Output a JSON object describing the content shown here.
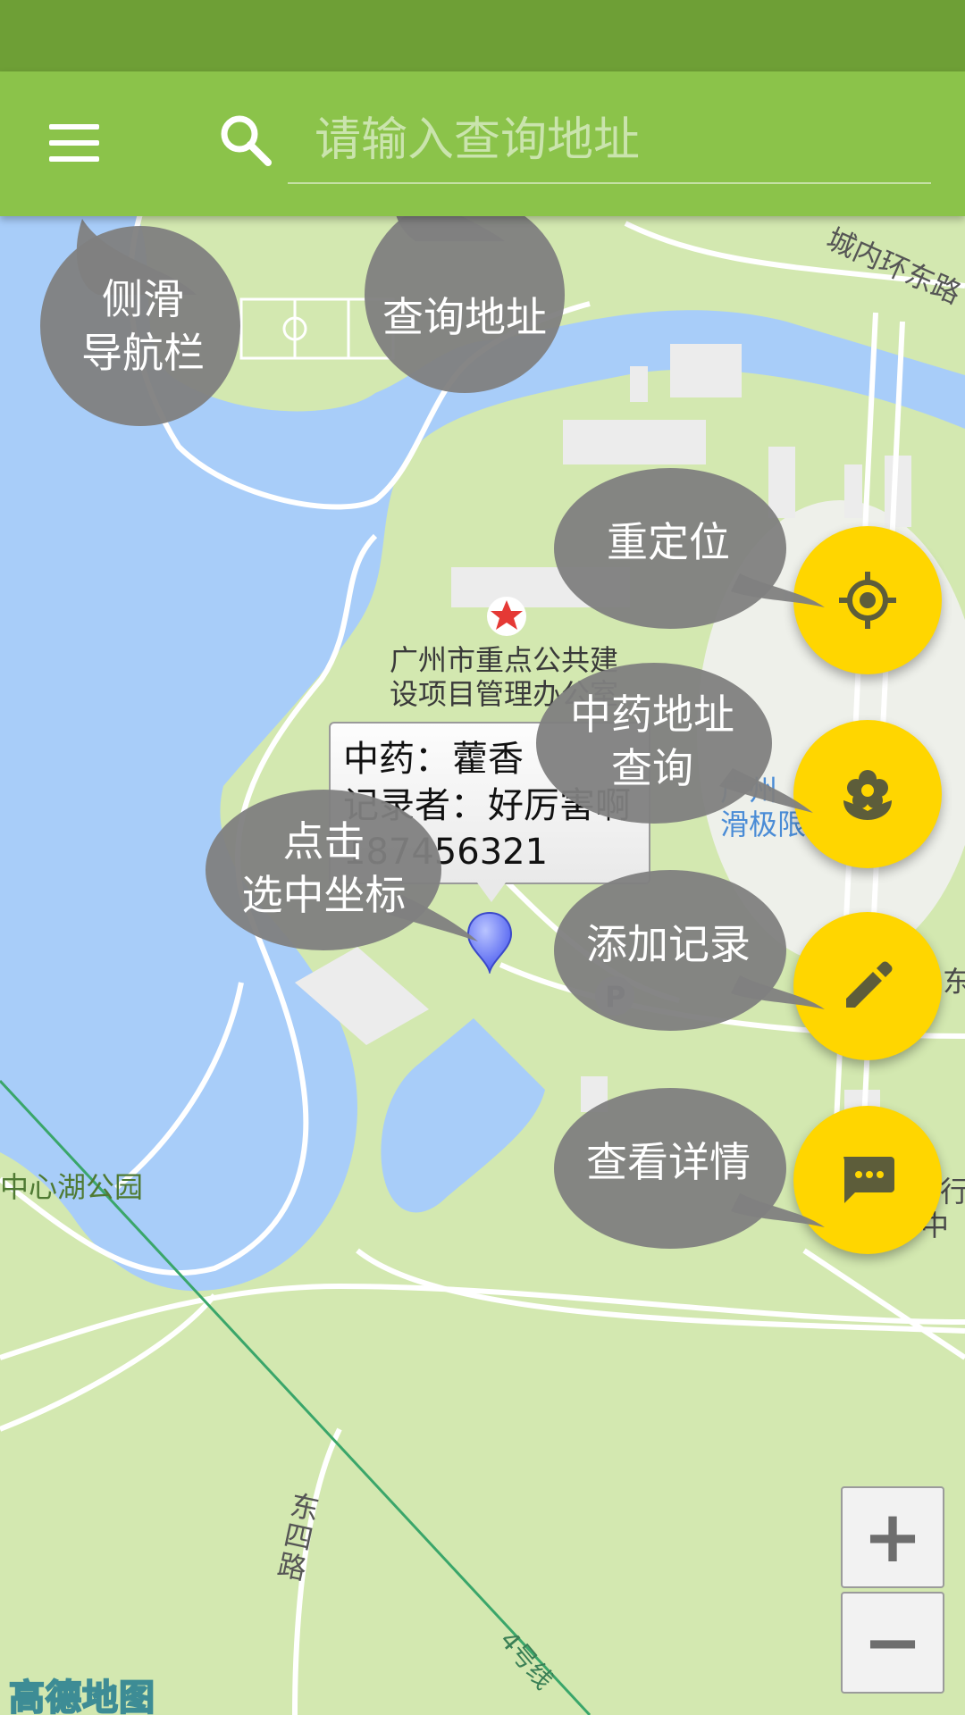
{
  "app_bar": {
    "search_placeholder": "请输入查询地址"
  },
  "colors": {
    "status_bar": "#6e9f36",
    "app_bar": "#8bc34a",
    "fab": "#ffd600",
    "bubble": "#808080",
    "water": "#a8cdf9",
    "park": "#d3e8b0"
  },
  "map": {
    "labels": {
      "poi_office": "广州市重点公共建\n设项目管理办公室",
      "road_east": "城内环东路",
      "park_lake": "中心湖公园",
      "ski_venue": "广州\n滑极限",
      "road_dongsi": "东\n四\n路",
      "road_line4": "4号线",
      "edge_dong": "东",
      "edge_xing": "行",
      "edge_zhong": "中",
      "parking": "P"
    },
    "logo": "高德地图"
  },
  "info_window": {
    "herb_label": "中药：",
    "herb_value": "藿香",
    "recorder_label": "记录者：",
    "recorder_value": "好厉害啊",
    "phone": "187456321"
  },
  "tooltips": {
    "side_nav": "侧滑\n导航栏",
    "search": "查询地址",
    "relocate": "重定位",
    "herb_query": "中药地址\n查询",
    "select_point": "点击\n选中坐标",
    "add_record": "添加记录",
    "view_details": "查看详情"
  },
  "fabs": [
    {
      "name": "relocate",
      "icon": "my-location-icon"
    },
    {
      "name": "herb-query",
      "icon": "flower-icon"
    },
    {
      "name": "add-record",
      "icon": "pencil-icon"
    },
    {
      "name": "view-details",
      "icon": "chat-bubble-icon"
    }
  ],
  "zoom": {
    "in_label": "+",
    "out_label": "−"
  }
}
